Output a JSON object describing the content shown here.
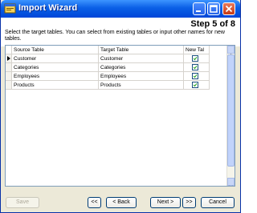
{
  "window": {
    "title": "Import Wizard",
    "accent": "#0a5fe6"
  },
  "header": {
    "step": "Step 5 of 8",
    "instruction": "Select the target tables. You can select from existing tables or input other names for new tables."
  },
  "grid": {
    "columns": [
      "Source Table",
      "Target Table",
      "New Tal"
    ],
    "rows": [
      {
        "source": "Customer",
        "target": "Customer",
        "new_table": true,
        "current": true
      },
      {
        "source": "Categories",
        "target": "Categories",
        "new_table": true,
        "current": false
      },
      {
        "source": "Employees",
        "target": "Employees",
        "new_table": true,
        "current": false
      },
      {
        "source": "Products",
        "target": "Products",
        "new_table": true,
        "current": false
      }
    ]
  },
  "buttons": {
    "save": "Save",
    "first": "<<",
    "back": "< Back",
    "next": "Next >",
    "last": ">>",
    "cancel": "Cancel"
  }
}
